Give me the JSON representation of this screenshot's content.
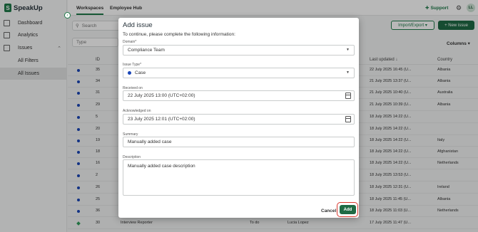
{
  "app": {
    "logo": "SpeakUp",
    "logo_mark": "S"
  },
  "sidebar": {
    "items": [
      {
        "label": "Dashboard",
        "icon": "dashboard-icon"
      },
      {
        "label": "Analytics",
        "icon": "analytics-icon"
      },
      {
        "label": "Issues",
        "icon": "issues-icon"
      }
    ],
    "sub_items": [
      "All Filters",
      "All Issues"
    ]
  },
  "topbar": {
    "tabs": [
      "Workspaces",
      "Employee Hub"
    ],
    "support": "Support",
    "avatar_initials": "LL"
  },
  "toolbar": {
    "search_placeholder": "Search",
    "import_export": "Import/Export",
    "new_issue": "+ New issue",
    "type_filter": "Type",
    "columns": "Columns"
  },
  "table": {
    "headers": {
      "id": "ID",
      "last_updated": "Last updated",
      "country": "Country"
    },
    "rows": [
      {
        "id": "35",
        "updated": "22 July 2025 16:45 (U...",
        "country": "Albania"
      },
      {
        "id": "34",
        "updated": "21 July 2025 13:37 (U...",
        "country": "Albania"
      },
      {
        "id": "31",
        "updated": "21 July 2025 10:40 (U...",
        "country": "Australia"
      },
      {
        "id": "29",
        "updated": "21 July 2025 10:39 (U...",
        "country": "Albania"
      },
      {
        "id": "5",
        "updated": "18 July 2025 14:22 (U...",
        "country": ""
      },
      {
        "id": "20",
        "updated": "18 July 2025 14:22 (U...",
        "country": ""
      },
      {
        "id": "19",
        "updated": "18 July 2025 14:22 (U...",
        "country": "Italy"
      },
      {
        "id": "18",
        "updated": "18 July 2025 14:22 (U...",
        "country": "Afghanistan"
      },
      {
        "id": "16",
        "updated": "18 July 2025 14:22 (U...",
        "country": "Netherlands"
      },
      {
        "id": "2",
        "updated": "18 July 2025 13:53 (U...",
        "country": ""
      },
      {
        "id": "26",
        "updated": "18 July 2025 12:31 (U...",
        "country": "Ireland"
      },
      {
        "id": "25",
        "updated": "18 July 2025 11:45 (U...",
        "country": "Albania"
      },
      {
        "id": "36",
        "updated": "18 July 2025 11:03 (U...",
        "country": "Netherlands"
      },
      {
        "id": "30",
        "updated": "17 July 2025 11:47 (U...",
        "country": "",
        "name": "Interview Reporter",
        "status": "To do",
        "assignee": "Lucia Lopez"
      }
    ]
  },
  "modal": {
    "title": "Add issue",
    "intro": "To continue, please complete the following information:",
    "domain_label": "Domain*",
    "domain_value": "Compliance Team",
    "type_label": "Issue Type*",
    "type_value": "Case",
    "received_label": "Received on",
    "received_value": "22 July 2025 13:00 (UTC+02:00)",
    "ack_label": "Acknowledged on",
    "ack_value": "23 July 2025 12:01 (UTC+02:00)",
    "summary_label": "Summary",
    "summary_value": "Manually added case",
    "description_label": "Description",
    "description_value": "Manually added case description",
    "cancel": "Cancel",
    "add": "Add"
  }
}
